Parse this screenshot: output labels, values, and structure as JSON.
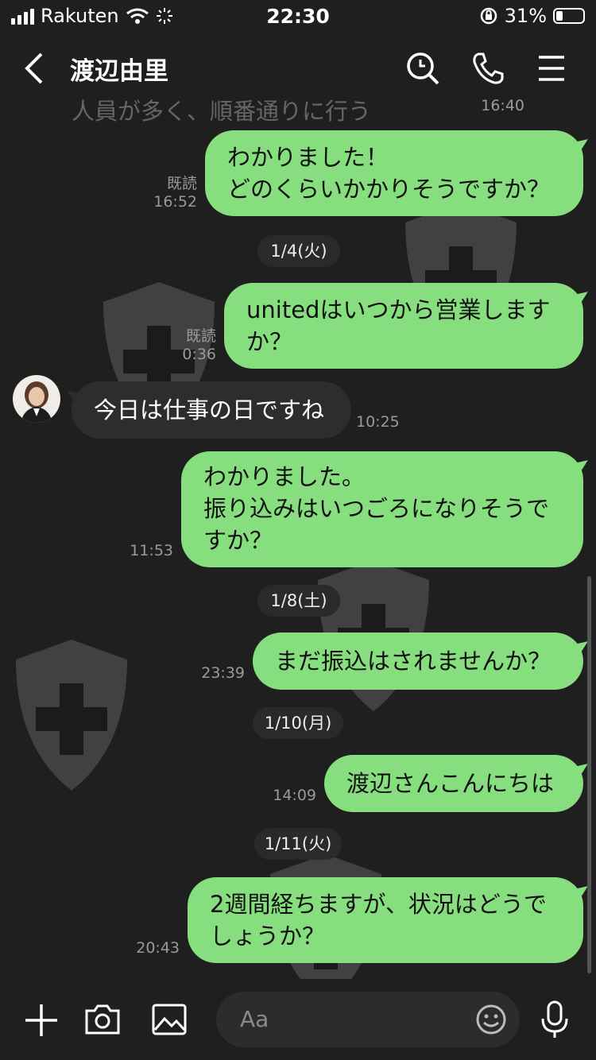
{
  "status": {
    "carrier": "Rakuten",
    "time": "22:30",
    "battery": "31%"
  },
  "header": {
    "title": "渡辺由里"
  },
  "top_partial": {
    "text": "人員が多く、順番通りに行う",
    "time": "16:40"
  },
  "messages": [
    {
      "line1": "わかりました！",
      "line2": "どのくらいかかりそうですか？",
      "read": "既読",
      "time": "16:52"
    },
    {
      "date": "1/4(火)"
    },
    {
      "line1": "unitedはいつから営業します",
      "line2": "か？",
      "read": "既読",
      "time": "0:36"
    },
    {
      "text": "今日は仕事の日ですね",
      "time": "10:25"
    },
    {
      "line1": "わかりました。",
      "line2": "振り込みはいつごろになりそうで",
      "line3": "すか？",
      "time": "11:53"
    },
    {
      "date": "1/8(土)"
    },
    {
      "text": "まだ振込はされませんか？",
      "time": "23:39"
    },
    {
      "date": "1/10(月)"
    },
    {
      "text": "渡辺さんこんにちは",
      "time": "14:09"
    },
    {
      "date": "1/11(火)"
    },
    {
      "line1": "2週間経ちますが、状況はどうで",
      "line2": "しょうか？",
      "time": "20:43"
    }
  ],
  "input": {
    "placeholder": "Aa"
  },
  "icons": {
    "back": "chevron-left-icon",
    "search": "search-icon",
    "call": "phone-icon",
    "menu": "menu-icon",
    "plus": "plus-icon",
    "camera": "camera-icon",
    "image": "image-icon",
    "emoji": "emoji-icon",
    "mic": "mic-icon"
  },
  "colors": {
    "background": "#1f1f1f",
    "outgoing_bubble": "#86de7e",
    "incoming_bubble": "#2d2d2d"
  }
}
